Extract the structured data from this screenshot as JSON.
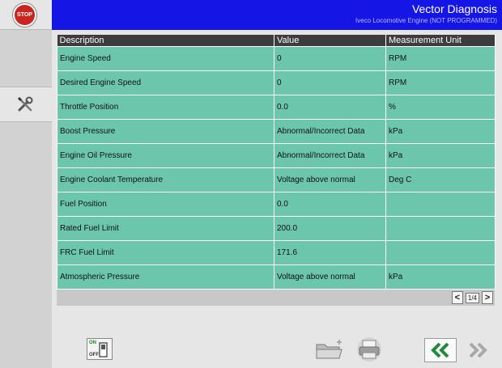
{
  "header": {
    "title": "Vector Diagnosis",
    "subtitle": "Iveco Locomotive Engine (NOT PROGRAMMED)"
  },
  "sidebar": {
    "stop_label": "STOP",
    "tool_icon": "wrench-screwdriver-icon"
  },
  "table": {
    "headers": [
      "Description",
      "Value",
      "Measurement Unit"
    ],
    "rows": [
      {
        "description": "Engine Speed",
        "value": "0",
        "unit": "RPM"
      },
      {
        "description": "Desired Engine Speed",
        "value": "0",
        "unit": "RPM"
      },
      {
        "description": "Throttle Position",
        "value": "0.0",
        "unit": "%"
      },
      {
        "description": "Boost Pressure",
        "value": "Abnormal/Incorrect Data",
        "unit": "kPa"
      },
      {
        "description": "Engine Oil Pressure",
        "value": "Abnormal/Incorrect Data",
        "unit": "kPa"
      },
      {
        "description": "Engine Coolant Temperature",
        "value": "Voltage above normal",
        "unit": "Deg C"
      },
      {
        "description": "Fuel Position",
        "value": "0.0",
        "unit": ""
      },
      {
        "description": "Rated Fuel Limit",
        "value": "200.0",
        "unit": ""
      },
      {
        "description": "FRC Fuel Limit",
        "value": "171.6",
        "unit": ""
      },
      {
        "description": "Atmospheric Pressure",
        "value": "Voltage above normal",
        "unit": "kPa"
      }
    ]
  },
  "pager": {
    "prev": "<",
    "label": "1/4",
    "next": ">"
  },
  "toolbar": {
    "on_label": "ON",
    "off_label": "OFF",
    "folder_icon": "folder-icon",
    "print_icon": "printer-icon",
    "back_icon": "double-chevron-left-icon",
    "forward_icon": "double-chevron-right-icon"
  },
  "colors": {
    "header_bg": "#1515e6",
    "row_bg": "#6cc6ac",
    "header_cell_bg": "#3c3c3c",
    "stop_red": "#c8261e",
    "nav_green": "#1f8a3a"
  }
}
